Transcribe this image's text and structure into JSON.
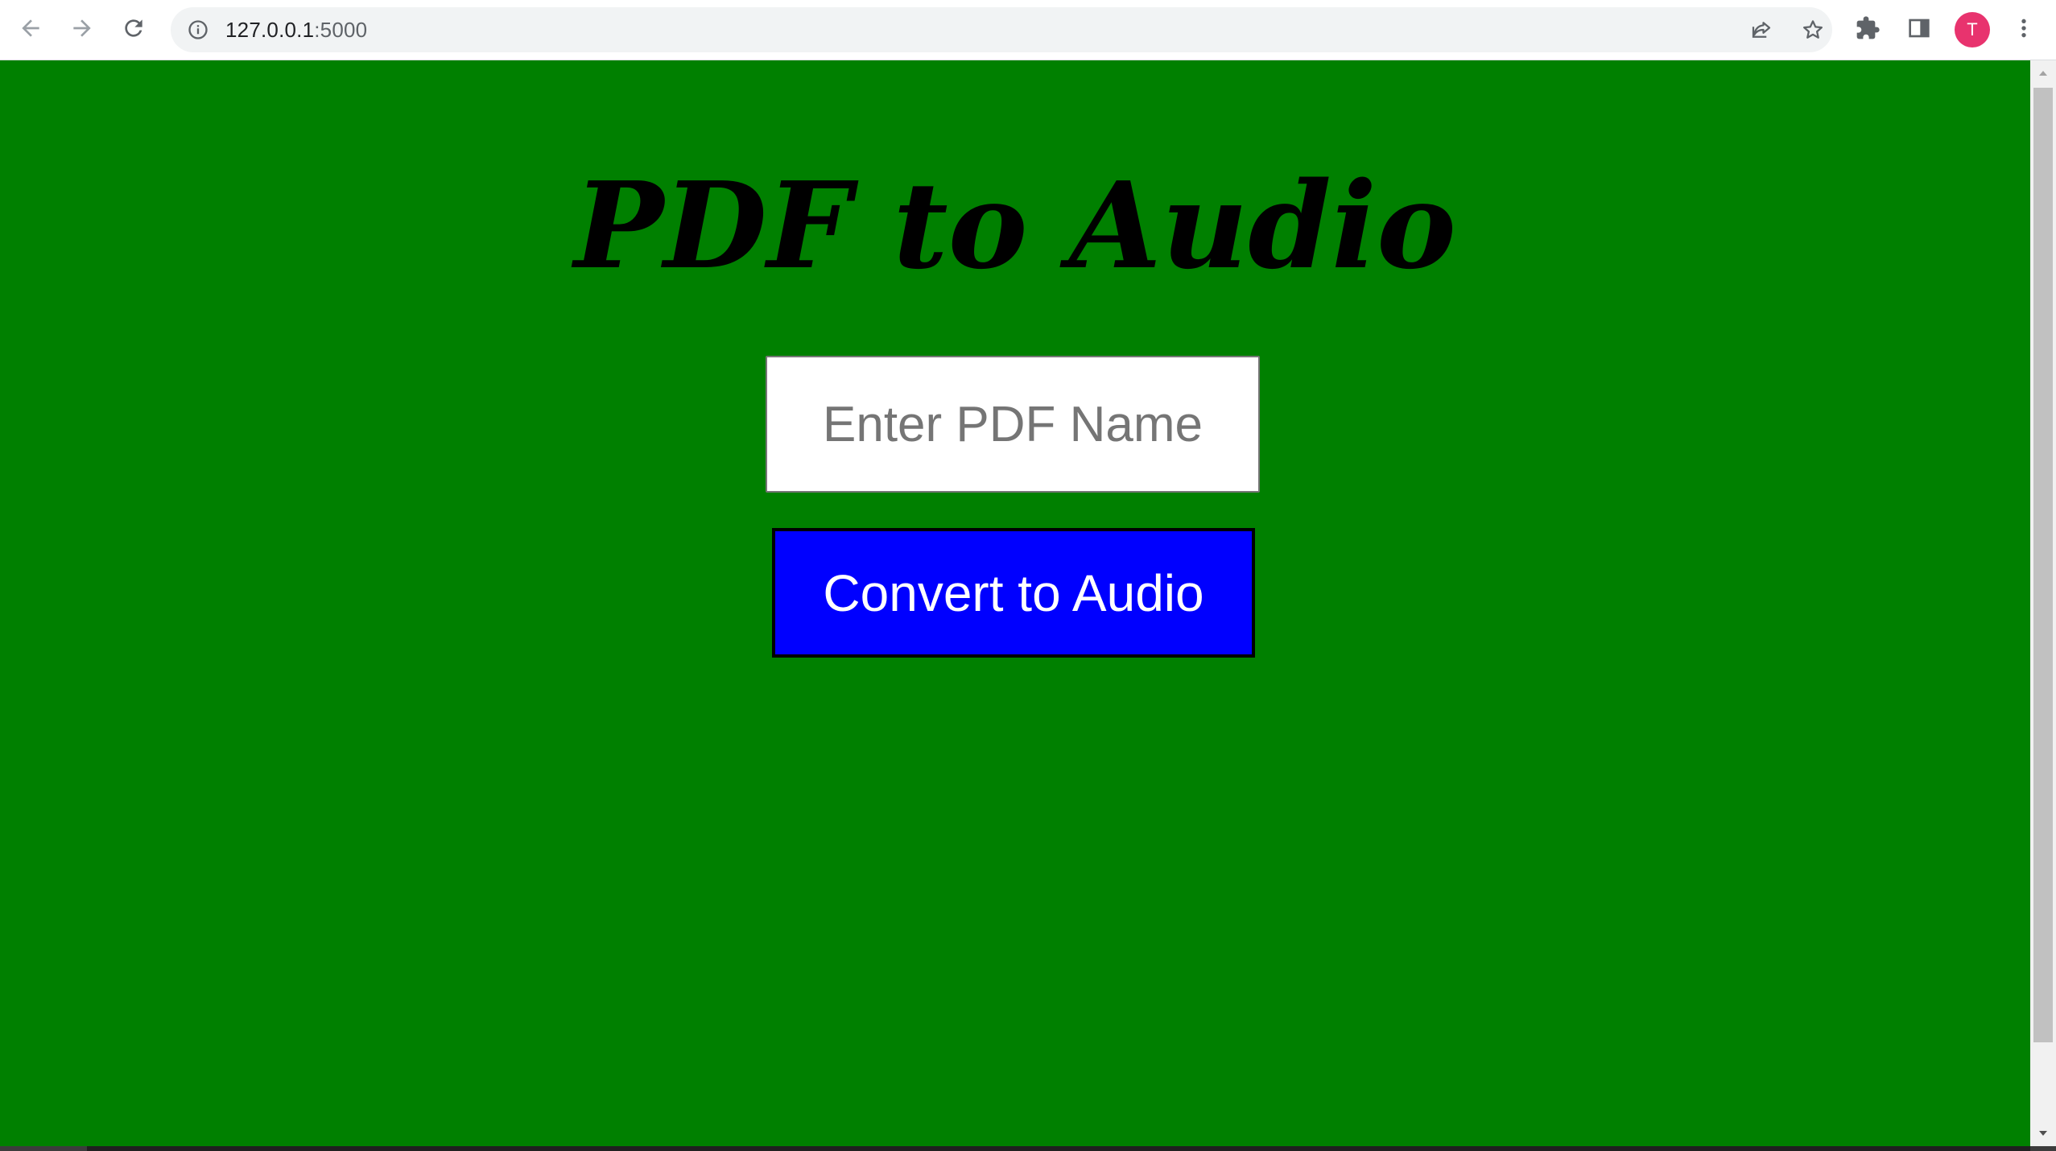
{
  "browser": {
    "url_host": "127.0.0.1",
    "url_port": ":5000",
    "avatar_initial": "T",
    "icons": {
      "back": "arrow-left-icon",
      "forward": "arrow-right-icon",
      "reload": "reload-icon",
      "site_info": "info-icon",
      "share": "share-icon",
      "bookmark": "star-icon",
      "extensions": "puzzle-icon",
      "side_panel": "side-panel-icon",
      "menu": "kebab-menu-icon"
    }
  },
  "page": {
    "title": "PDF to Audio",
    "input_placeholder": "Enter PDF Name",
    "input_value": "",
    "convert_button_label": "Convert to Audio"
  },
  "colors": {
    "page_background": "#008000",
    "button_background": "#0000ff",
    "button_text": "#ffffff",
    "title_text": "#000000",
    "avatar_background": "#e8336e"
  }
}
